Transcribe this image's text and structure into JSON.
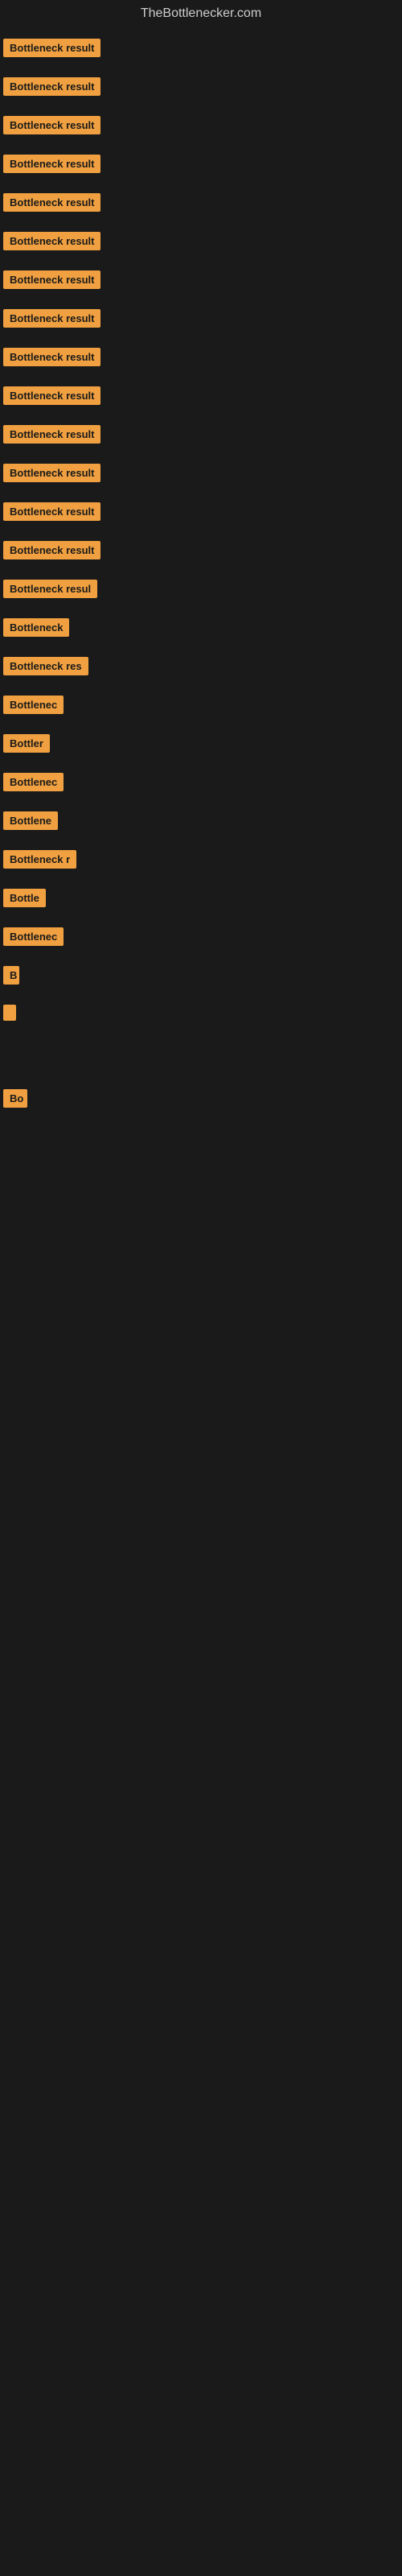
{
  "site": {
    "title": "TheBottlenecker.com"
  },
  "items": [
    {
      "label": "Bottleneck result",
      "width": 160
    },
    {
      "label": "Bottleneck result",
      "width": 160
    },
    {
      "label": "Bottleneck result",
      "width": 160
    },
    {
      "label": "Bottleneck result",
      "width": 160
    },
    {
      "label": "Bottleneck result",
      "width": 160
    },
    {
      "label": "Bottleneck result",
      "width": 160
    },
    {
      "label": "Bottleneck result",
      "width": 160
    },
    {
      "label": "Bottleneck result",
      "width": 160
    },
    {
      "label": "Bottleneck result",
      "width": 160
    },
    {
      "label": "Bottleneck result",
      "width": 160
    },
    {
      "label": "Bottleneck result",
      "width": 155
    },
    {
      "label": "Bottleneck result",
      "width": 150
    },
    {
      "label": "Bottleneck result",
      "width": 148
    },
    {
      "label": "Bottleneck result",
      "width": 145
    },
    {
      "label": "Bottleneck resul",
      "width": 135
    },
    {
      "label": "Bottleneck",
      "width": 90
    },
    {
      "label": "Bottleneck res",
      "width": 110
    },
    {
      "label": "Bottlenec",
      "width": 80
    },
    {
      "label": "Bottler",
      "width": 65
    },
    {
      "label": "Bottlenec",
      "width": 80
    },
    {
      "label": "Bottlene",
      "width": 75
    },
    {
      "label": "Bottleneck r",
      "width": 95
    },
    {
      "label": "Bottle",
      "width": 60
    },
    {
      "label": "Bottlenec",
      "width": 80
    },
    {
      "label": "B",
      "width": 20
    },
    {
      "label": "",
      "width": 8
    },
    {
      "label": "",
      "width": 0
    },
    {
      "label": "",
      "width": 0
    },
    {
      "label": "",
      "width": 0
    },
    {
      "label": "Bo",
      "width": 30
    },
    {
      "label": "",
      "width": 0
    },
    {
      "label": "",
      "width": 0
    },
    {
      "label": "",
      "width": 0
    }
  ]
}
